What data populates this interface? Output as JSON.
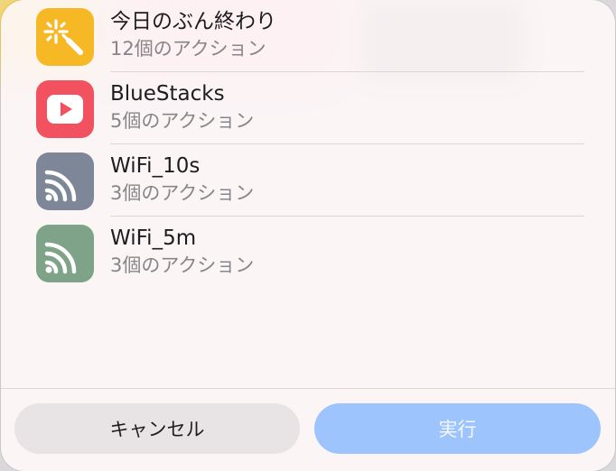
{
  "shortcuts": [
    {
      "title": "今日のぶん終わり",
      "subtitle": "12個のアクション",
      "icon": "magic-wand-icon",
      "color": "#f7b825"
    },
    {
      "title": "BlueStacks",
      "subtitle": "5個のアクション",
      "icon": "play-icon",
      "color": "#f2525f"
    },
    {
      "title": "WiFi_10s",
      "subtitle": "3個のアクション",
      "icon": "wifi-icon",
      "color": "#7d8797"
    },
    {
      "title": "WiFi_5m",
      "subtitle": "3個のアクション",
      "icon": "wifi-icon",
      "color": "#7fa388"
    }
  ],
  "buttons": {
    "cancel_label": "キャンセル",
    "run_label": "実行"
  }
}
